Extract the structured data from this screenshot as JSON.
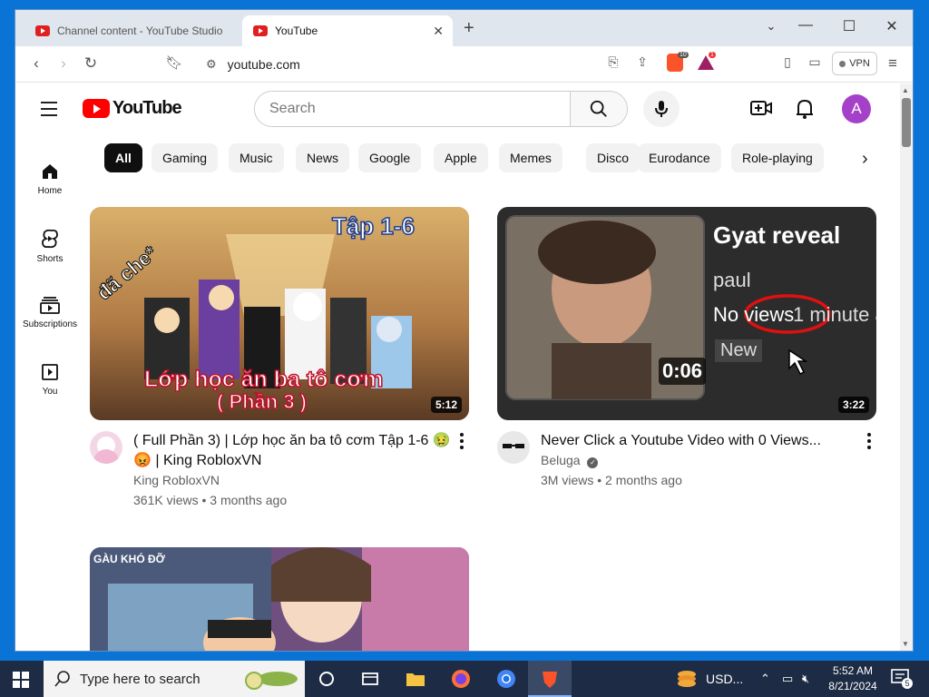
{
  "browser": {
    "tabs": [
      {
        "label": "Channel content - YouTube Studio",
        "active": false
      },
      {
        "label": "YouTube",
        "active": true
      }
    ],
    "address": "youtube.com",
    "vpn_label": "VPN",
    "brave_badge": "10",
    "rewards_badge": "1"
  },
  "youtube": {
    "logo_text": "YouTube",
    "search_placeholder": "Search",
    "avatar_letter": "A",
    "chips": [
      "All",
      "Gaming",
      "Music",
      "News",
      "Google",
      "Apple",
      "Memes",
      "Disco",
      "Eurodance",
      "Role-playing"
    ],
    "guide": [
      {
        "label": "Home",
        "icon": "home-icon"
      },
      {
        "label": "Shorts",
        "icon": "shorts-icon"
      },
      {
        "label": "Subscriptions",
        "icon": "subscriptions-icon"
      },
      {
        "label": "You",
        "icon": "you-icon"
      }
    ],
    "videos": [
      {
        "title_line1": "( Full Phần 3) | Lớp học ăn ba tô cơm Tập 1-6 🤢",
        "title_line2": "😡 | King RobloxVN",
        "channel": "King RobloxVN",
        "stats": "361K views • 3 months ago",
        "duration": "5:12",
        "thumb_top": "Tập 1-6",
        "thumb_side": "đã che*",
        "thumb_line1": "Lớp học ăn ba tô cơm",
        "thumb_line2": "( Phần 3 )"
      },
      {
        "title_line1": "Never Click a Youtube Video with 0 Views...",
        "channel": "Beluga",
        "stats": "3M views • 2 months ago",
        "duration": "3:22",
        "thumb_title": "Gyat reveal",
        "thumb_channel": "paul",
        "thumb_views": "No views",
        "thumb_time": "1 minute ago",
        "thumb_new": "New",
        "thumb_duration": "0:06"
      },
      {
        "thumb_text": "GÀU KHÓ ĐỠ"
      }
    ]
  },
  "taskbar": {
    "search_placeholder": "Type here to search",
    "currency": "USD...",
    "time": "5:52 AM",
    "date": "8/21/2024",
    "notifications": "5"
  }
}
